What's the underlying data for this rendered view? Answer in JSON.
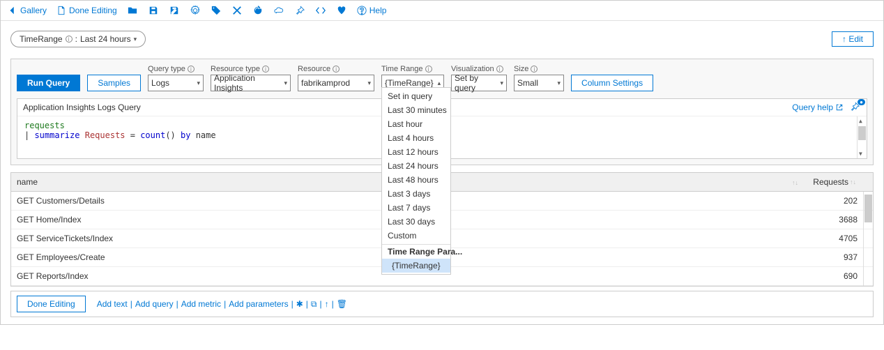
{
  "toolbar": {
    "gallery": "Gallery",
    "done_editing": "Done Editing",
    "help": "Help"
  },
  "time_pill": {
    "prefix": "TimeRange",
    "sep": ": ",
    "value": "Last 24 hours"
  },
  "edit_button": "↑ Edit",
  "query_controls": {
    "run_query": "Run Query",
    "samples": "Samples",
    "query_type_label": "Query type",
    "query_type_value": "Logs",
    "resource_type_label": "Resource type",
    "resource_type_value": "Application Insights",
    "resource_label": "Resource",
    "resource_value": "fabrikamprod",
    "time_range_label": "Time Range",
    "time_range_value": "{TimeRange}",
    "visualization_label": "Visualization",
    "visualization_value": "Set by query",
    "size_label": "Size",
    "size_value": "Small",
    "column_settings": "Column Settings"
  },
  "time_range_dropdown": {
    "items": [
      "Set in query",
      "Last 30 minutes",
      "Last hour",
      "Last 4 hours",
      "Last 12 hours",
      "Last 24 hours",
      "Last 48 hours",
      "Last 3 days",
      "Last 7 days",
      "Last 30 days",
      "Custom"
    ],
    "header": "Time Range Para...",
    "selected": "{TimeRange}"
  },
  "query_box": {
    "title": "Application Insights Logs Query",
    "help_label": "Query help",
    "line1": "requests",
    "line2_pipe": "| ",
    "line2_kw1": "summarize",
    "line2_var": "Requests",
    "line2_eq": " = ",
    "line2_fn": "count",
    "line2_paren": "() ",
    "line2_kw2": "by",
    "line2_name": " name"
  },
  "results": {
    "columns": {
      "name": "name",
      "requests": "Requests"
    },
    "rows": [
      {
        "name": "GET Customers/Details",
        "requests": "202"
      },
      {
        "name": "GET Home/Index",
        "requests": "3688"
      },
      {
        "name": "GET ServiceTickets/Index",
        "requests": "4705"
      },
      {
        "name": "GET Employees/Create",
        "requests": "937"
      },
      {
        "name": "GET Reports/Index",
        "requests": "690"
      }
    ]
  },
  "footer": {
    "done_editing": "Done Editing",
    "add_text": "Add text",
    "add_query": "Add query",
    "add_metric": "Add metric",
    "add_parameters": "Add parameters"
  }
}
